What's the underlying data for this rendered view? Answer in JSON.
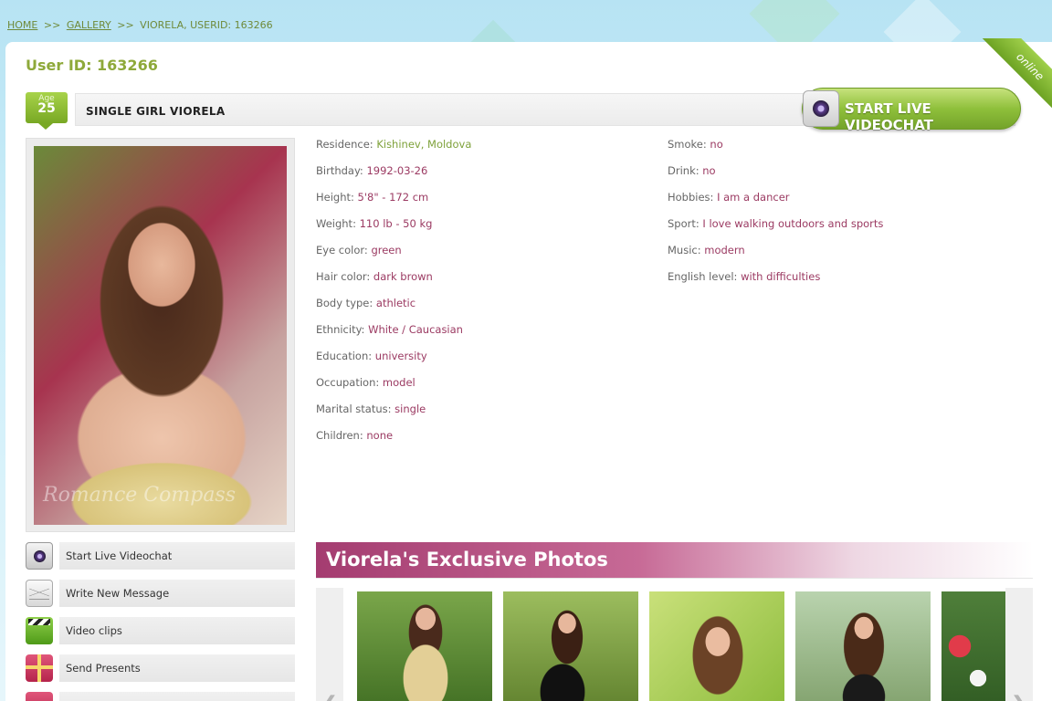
{
  "breadcrumb": {
    "home": "HOME",
    "gallery": "GALLERY",
    "separator": ">>",
    "current": "VIORELA, USERID: 163266"
  },
  "status_ribbon": "online",
  "profile": {
    "user_id_text": "User ID: 163266",
    "age_label": "Age",
    "age_value": "25",
    "name_title": "SINGLE GIRL VIORELA",
    "photo_watermark": "Romance Compass"
  },
  "videochat_button": {
    "label": "START LIVE VIDEOCHAT",
    "icon": "webcam-icon"
  },
  "details_left": [
    {
      "key": "Residence:",
      "value": "Kishinev, Moldova"
    },
    {
      "key": "Birthday:",
      "value": "1992-03-26"
    },
    {
      "key": "Height:",
      "value": "5'8\" - 172 cm"
    },
    {
      "key": "Weight:",
      "value": "110 lb - 50 kg"
    },
    {
      "key": "Eye color:",
      "value": "green"
    },
    {
      "key": "Hair color:",
      "value": "dark brown"
    },
    {
      "key": "Body type:",
      "value": "athletic"
    },
    {
      "key": "Ethnicity:",
      "value": "White / Caucasian"
    },
    {
      "key": "Education:",
      "value": "university"
    },
    {
      "key": "Occupation:",
      "value": "model"
    },
    {
      "key": "Marital status:",
      "value": "single"
    },
    {
      "key": "Children:",
      "value": "none"
    }
  ],
  "details_right": [
    {
      "key": "Smoke:",
      "value": "no"
    },
    {
      "key": "Drink:",
      "value": "no"
    },
    {
      "key": "Hobbies:",
      "value": "I am a dancer"
    },
    {
      "key": "Sport:",
      "value": "I love walking outdoors and sports"
    },
    {
      "key": "Music:",
      "value": "modern"
    },
    {
      "key": "English level:",
      "value": "with difficulties"
    }
  ],
  "side_menu": [
    {
      "label": "Start Live Videochat",
      "icon": "webcam-icon"
    },
    {
      "label": "Write New Message",
      "icon": "envelope-icon"
    },
    {
      "label": "Video clips",
      "icon": "clapperboard-icon"
    },
    {
      "label": "Send Presents",
      "icon": "gift-icon"
    }
  ],
  "exclusive": {
    "title": "Viorela's Exclusive Photos",
    "prev_arrow": "❮",
    "next_arrow": "❯"
  },
  "colors": {
    "accent_green": "#8ea93a",
    "value_purple": "#9b3a62",
    "banner_magenta": "#a43c70"
  }
}
